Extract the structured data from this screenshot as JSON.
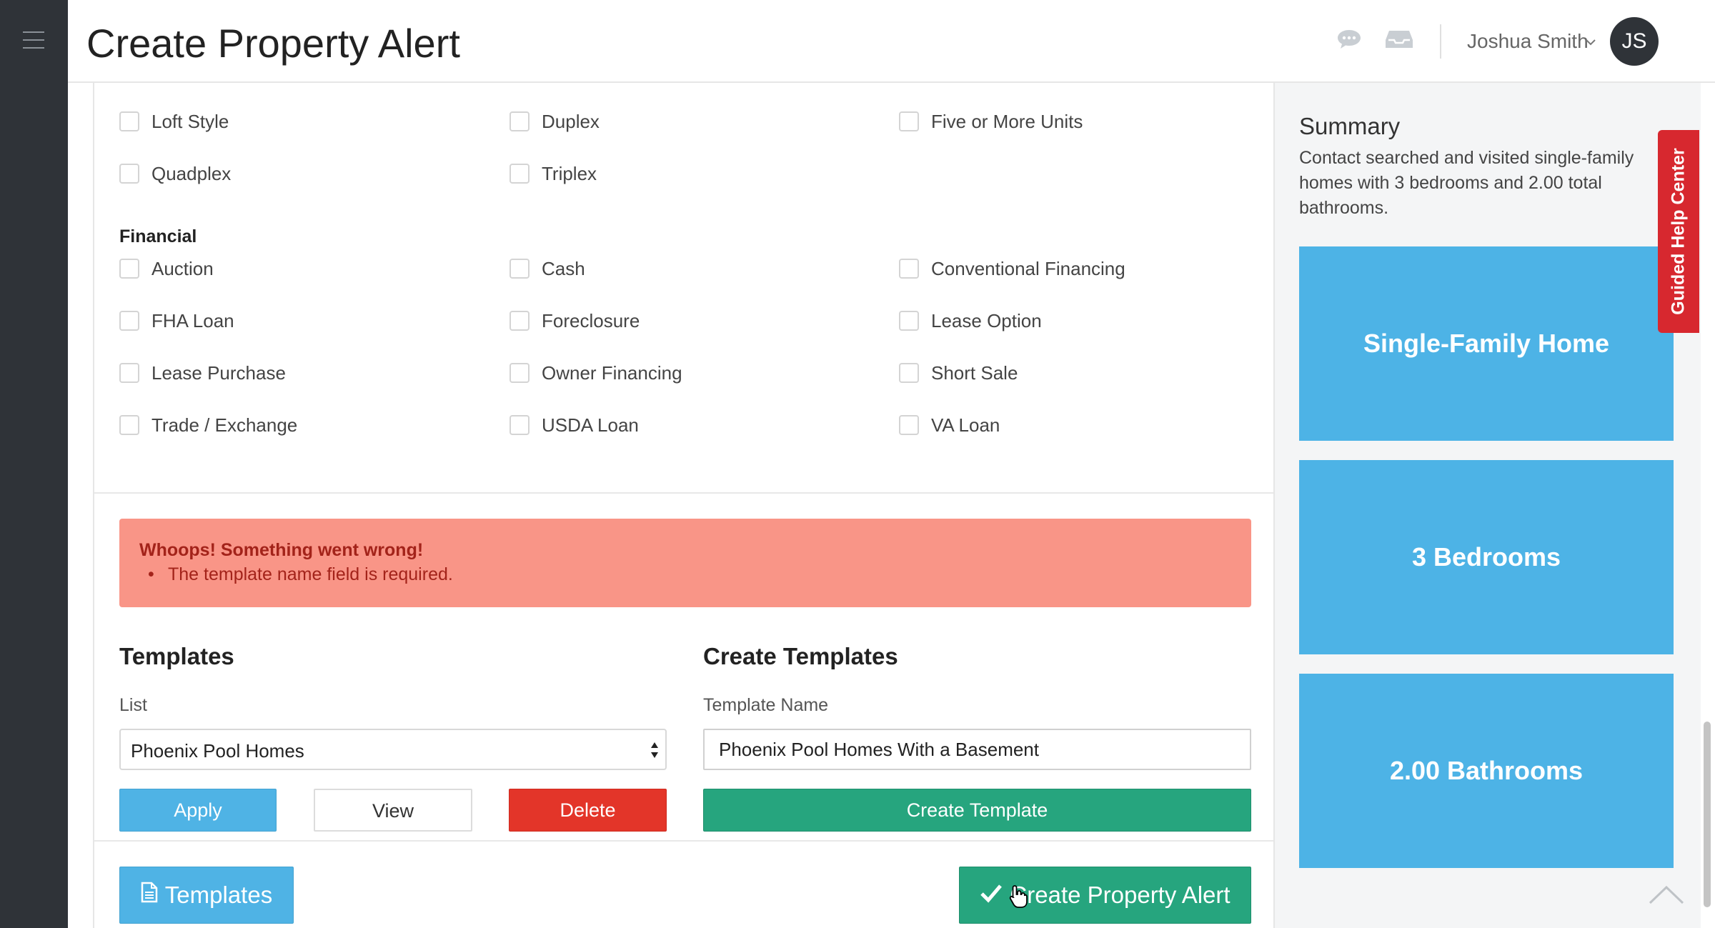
{
  "header": {
    "title": "Create Property Alert",
    "user_name": "Joshua Smith",
    "avatar_initials": "JS"
  },
  "property_types": {
    "items": [
      {
        "label": "Loft Style"
      },
      {
        "label": "Duplex"
      },
      {
        "label": "Five or More Units"
      },
      {
        "label": "Quadplex"
      },
      {
        "label": "Triplex"
      }
    ]
  },
  "financial": {
    "heading": "Financial",
    "items": [
      {
        "label": "Auction"
      },
      {
        "label": "Cash"
      },
      {
        "label": "Conventional Financing"
      },
      {
        "label": "FHA Loan"
      },
      {
        "label": "Foreclosure"
      },
      {
        "label": "Lease Option"
      },
      {
        "label": "Lease Purchase"
      },
      {
        "label": "Owner Financing"
      },
      {
        "label": "Short Sale"
      },
      {
        "label": "Trade / Exchange"
      },
      {
        "label": "USDA Loan"
      },
      {
        "label": "VA Loan"
      }
    ]
  },
  "error_alert": {
    "title": "Whoops! Something went wrong!",
    "bullet": "•",
    "message": "The template name field is required."
  },
  "templates": {
    "heading": "Templates",
    "list_label": "List",
    "selected_value": "Phoenix Pool Homes",
    "apply_label": "Apply",
    "view_label": "View",
    "delete_label": "Delete"
  },
  "create_templates": {
    "heading": "Create Templates",
    "name_label": "Template Name",
    "name_value": "Phoenix Pool Homes With a Basement",
    "button_label": "Create Template"
  },
  "footer_actions": {
    "templates_label": "Templates",
    "create_alert_label": "Create Property Alert"
  },
  "summary": {
    "title": "Summary",
    "text": "Contact searched and visited single-family homes with 3 bedrooms and 2.00 total bathrooms.",
    "tiles": [
      "Single-Family Home",
      "3 Bedrooms",
      "2.00 Bathrooms"
    ]
  },
  "help_tab": {
    "label": "Guided Help Center"
  },
  "colors": {
    "sidebar": "#2f3338",
    "primary_blue": "#4fb3e5",
    "success_green": "#26a57e",
    "danger_red": "#e33529",
    "alert_bg": "#f99587",
    "alert_text": "#a3231a",
    "help_red": "#d7282f"
  },
  "icons": {
    "menu": "hamburger-icon",
    "chat": "chat-icon",
    "inbox": "inbox-icon",
    "dropdown": "chevron-down-icon",
    "select": "select-arrows-icon",
    "document": "document-icon",
    "check": "check-icon",
    "scroll_top": "chevron-up-icon",
    "cursor": "hand-cursor-icon"
  }
}
